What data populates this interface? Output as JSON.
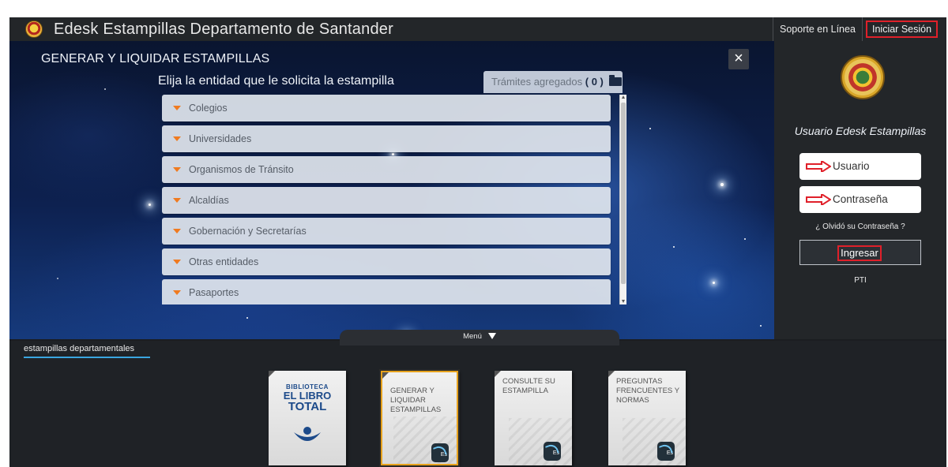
{
  "header": {
    "app_title": "Edesk Estampillas Departamento de Santander",
    "support_label": "Soporte en Línea",
    "login_label": "Iniciar Sesión"
  },
  "main": {
    "section_title": "GENERAR Y LIQUIDAR ESTAMPILLAS",
    "close_label": "×",
    "subtitle": "Elija la entidad que le solicita la estampilla",
    "tramites_label": "Trámites agregados",
    "tramites_count": "( 0 )",
    "entities": [
      "Colegios",
      "Universidades",
      "Organismos de Tránsito",
      "Alcaldías",
      "Gobernación y Secretarías",
      "Otras entidades",
      "Pasaportes"
    ]
  },
  "login": {
    "user_title": "Usuario Edesk Estampillas",
    "username_placeholder": "Usuario",
    "password_placeholder": "Contraseña",
    "forgot_label": "¿ Olvidó su Contraseña ?",
    "submit_label": "Ingresar",
    "pti_label": "PTI"
  },
  "menu": {
    "toggle_label": "Menú",
    "tab_label": "estampillas departamentales",
    "library_tile": {
      "line1": "BIBLIOTECA",
      "line2": "EL LIBRO",
      "line3": "TOTAL"
    },
    "tiles": [
      "GENERAR Y LIQUIDAR ESTAMPILLAS",
      "CONSULTE SU ESTAMPILLA",
      "PREGUNTAS FRENCUENTES Y NORMAS"
    ],
    "tile_icon_text": "Es"
  },
  "colors": {
    "highlight": "#e0202a",
    "accent_orange": "#f07a1f",
    "selected_tile_border": "#e7a21d",
    "panel_bg": "#232629"
  }
}
